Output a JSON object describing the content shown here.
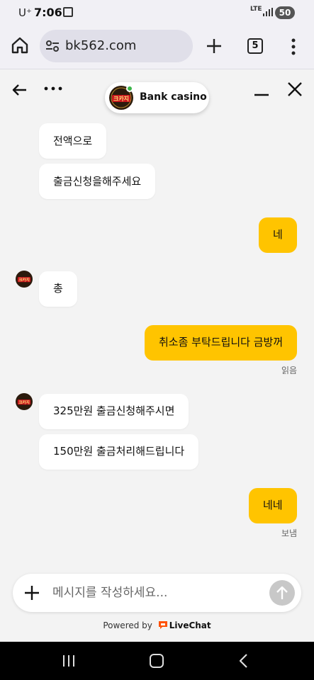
{
  "status_bar": {
    "carrier": "U⁺",
    "time": "7:06",
    "network": "LTE",
    "battery": "50"
  },
  "browser": {
    "url": "bk562.com",
    "tab_count": "5"
  },
  "chat": {
    "agent_name": "Bank casino",
    "avatar_text": "크카지",
    "agent_online": true,
    "messages": [
      {
        "from": "agent",
        "text": "전액으로"
      },
      {
        "from": "agent",
        "text": "출금신청을해주세요"
      },
      {
        "from": "user",
        "text": "네"
      },
      {
        "from": "agent",
        "text": "총"
      },
      {
        "from": "user",
        "text": "취소좀 부탁드립니다 금방꺼",
        "status": "읽음"
      },
      {
        "from": "agent",
        "text": "325만원 출금신청해주시면"
      },
      {
        "from": "agent",
        "text": "150만원 출금처리해드립니다"
      },
      {
        "from": "user",
        "text": "네네",
        "status": "보냄"
      }
    ]
  },
  "composer": {
    "placeholder": "메시지를 작성하세요..."
  },
  "footer": {
    "powered_by": "Powered by",
    "brand": "LiveChat"
  },
  "colors": {
    "user_bubble": "#ffc400",
    "agent_bubble": "#ffffff",
    "online_dot": "#3bb54a",
    "livechat_brand": "#ff5100"
  }
}
